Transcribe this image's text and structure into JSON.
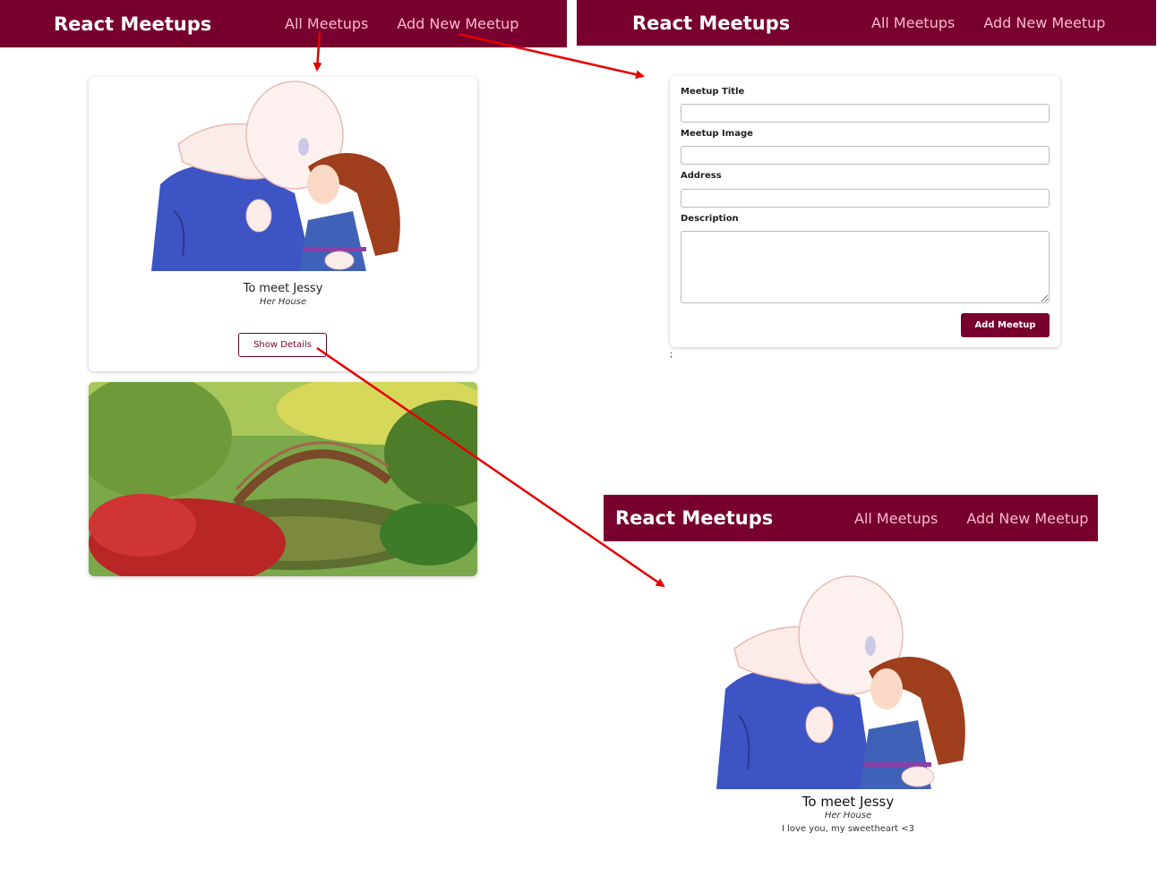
{
  "header": {
    "logo": "React Meetups",
    "nav": {
      "all_meetups": "All Meetups",
      "add_new_meetup": "Add New Meetup"
    }
  },
  "meetup_list": {
    "items": [
      {
        "title": "To meet Jessy",
        "address": "Her House",
        "details_label": "Show Details",
        "image": "anime-couple-embrace"
      },
      {
        "image": "japanese-garden-bridge"
      }
    ]
  },
  "new_meetup_form": {
    "title_label": "Meetup Title",
    "image_label": "Meetup Image",
    "address_label": "Address",
    "description_label": "Description",
    "submit_label": "Add Meetup",
    "stray_text": ";"
  },
  "meetup_detail": {
    "title": "To meet Jessy",
    "address": "Her House",
    "description": "I love you, my sweetheart <3",
    "image": "anime-couple-embrace"
  },
  "annotation_arrow_color": "#e60000",
  "colors": {
    "brand": "#77002e",
    "nav_link": "#fcb8d2"
  }
}
